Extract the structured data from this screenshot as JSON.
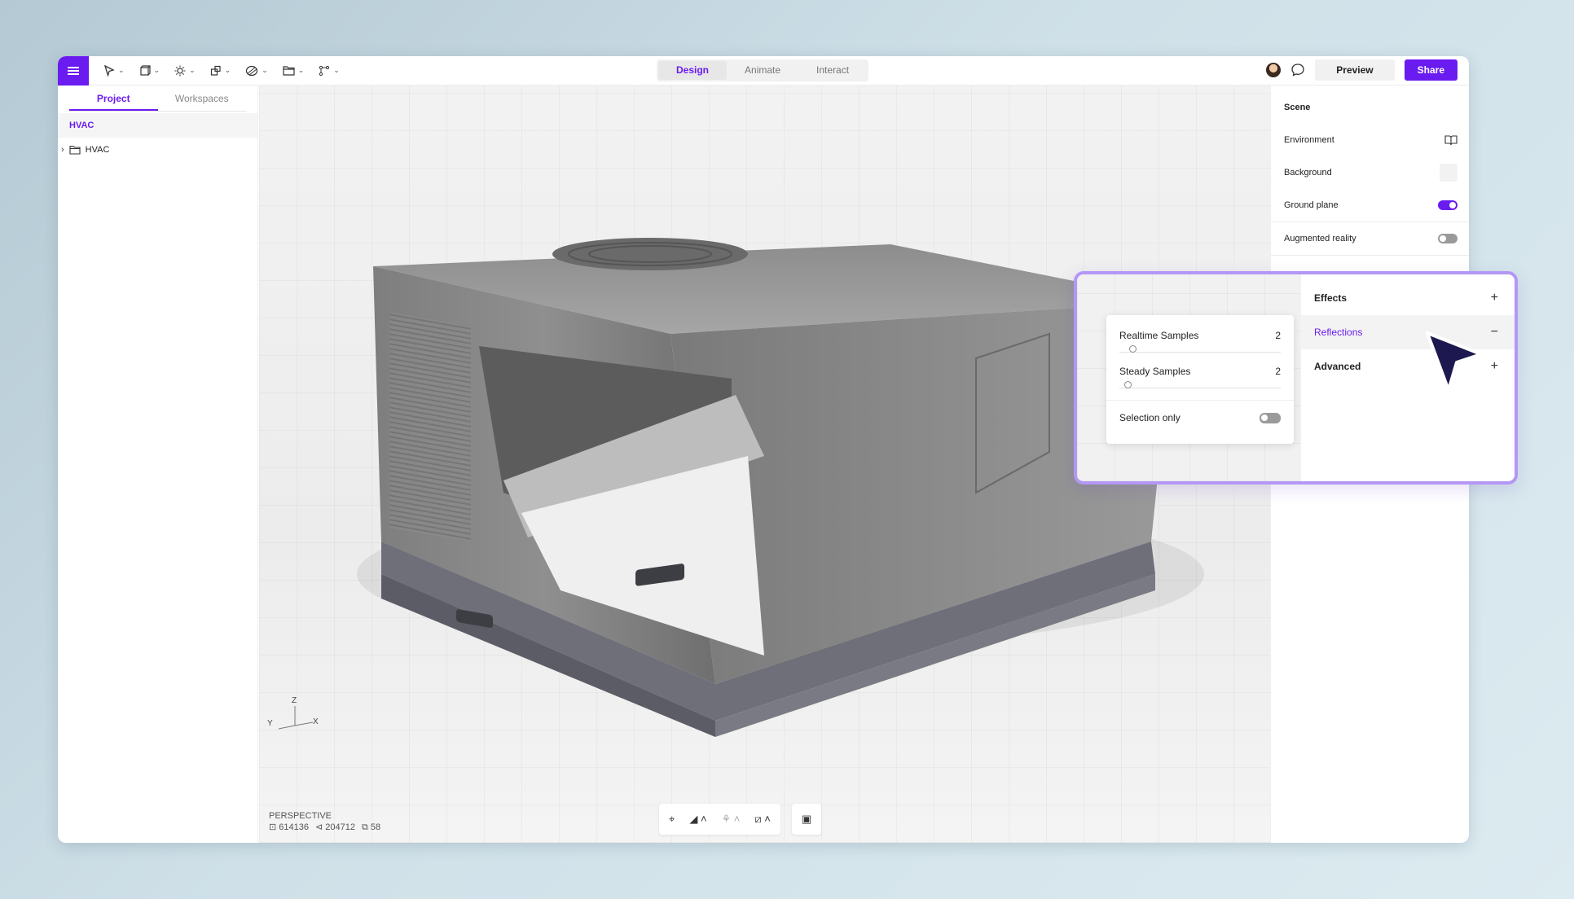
{
  "toolbar": {
    "menu_icon": "hamburger-icon",
    "tools": [
      "select-tool-icon",
      "cube-tool-icon",
      "light-tool-icon",
      "instance-tool-icon",
      "material-tool-icon",
      "folder-tool-icon",
      "path-tool-icon"
    ],
    "modes": [
      "Design",
      "Animate",
      "Interact"
    ],
    "active_mode": "Design",
    "preview_label": "Preview",
    "share_label": "Share",
    "accent": "#6a1bf0"
  },
  "left_panel": {
    "tabs": [
      "Project",
      "Workspaces"
    ],
    "active_tab": "Project",
    "project_name": "HVAC",
    "tree": [
      {
        "label": "HVAC",
        "icon": "folder-icon"
      }
    ]
  },
  "viewport": {
    "axes": {
      "z": "Z",
      "y": "Y",
      "x": "X"
    },
    "camera": "PERSPECTIVE",
    "stats": {
      "vertices": "614136",
      "edges": "204712",
      "objects": "58"
    }
  },
  "right_panel": {
    "section_title": "Scene",
    "environment_label": "Environment",
    "background_label": "Background",
    "ground_plane_label": "Ground plane",
    "ground_plane_on": true,
    "augmented_reality_label": "Augmented reality",
    "augmented_reality_on": false
  },
  "callout": {
    "realtime_samples_label": "Realtime Samples",
    "realtime_samples_value": "2",
    "steady_samples_label": "Steady Samples",
    "steady_samples_value": "2",
    "selection_only_label": "Selection only",
    "selection_only_on": false,
    "effects_label": "Effects",
    "reflections_label": "Reflections",
    "advanced_label": "Advanced"
  }
}
